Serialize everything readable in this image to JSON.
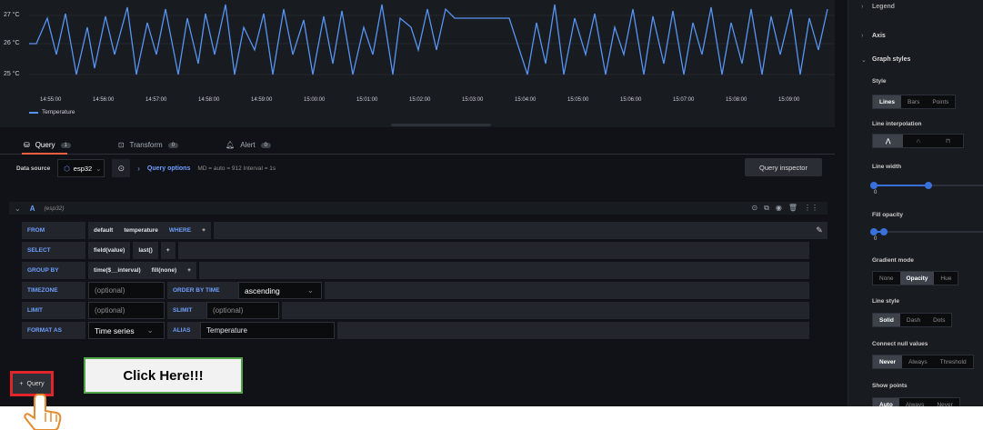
{
  "graph": {
    "y_ticks": [
      "27 °C",
      "26 °C",
      "25 °C"
    ],
    "x_ticks": [
      "14:55:00",
      "14:56:00",
      "14:57:00",
      "14:58:00",
      "14:59:00",
      "15:00:00",
      "15:01:00",
      "15:02:00",
      "15:03:00",
      "15:04:00",
      "15:05:00",
      "15:06:00",
      "15:07:00",
      "15:08:00",
      "15:09:00"
    ],
    "legend": "Temperature",
    "series_color": "#5794f2"
  },
  "tabs": [
    {
      "label": "Query",
      "count": "1"
    },
    {
      "label": "Transform",
      "count": "0"
    },
    {
      "label": "Alert",
      "count": "0"
    }
  ],
  "datasource": {
    "label": "Data source",
    "value": "esp32",
    "query_options": "Query options",
    "meta": "MD = auto = 912   Interval = 1s",
    "inspector": "Query inspector"
  },
  "query": {
    "letter": "A",
    "ds_name": "(esp32)",
    "from": {
      "kw": "FROM",
      "policy": "default",
      "measurement": "temperature",
      "where": "WHERE",
      "plus": "+"
    },
    "select": {
      "kw": "SELECT",
      "field": "field(value)",
      "fn": "last()",
      "plus": "+"
    },
    "group_by": {
      "kw": "GROUP BY",
      "time": "time($__interval)",
      "fill": "fill(none)",
      "plus": "+"
    },
    "timezone": {
      "kw": "TIMEZONE",
      "placeholder": "(optional)",
      "order_kw": "ORDER BY TIME",
      "order_val": "ascending"
    },
    "limit": {
      "kw": "LIMIT",
      "placeholder": "(optional)",
      "slimit_kw": "SLIMIT",
      "slimit_placeholder": "(optional)"
    },
    "format": {
      "kw": "FORMAT AS",
      "value": "Time series",
      "alias_kw": "ALIAS",
      "alias_val": "Temperature"
    }
  },
  "add_query": "Query",
  "add_query_plus": "+",
  "callout": "Click Here!!!",
  "right_panel": {
    "legend": "Legend",
    "axis": "Axis",
    "graph_styles": "Graph styles",
    "style_label": "Style",
    "style_opts": [
      "Lines",
      "Bars",
      "Points"
    ],
    "line_interp": "Line interpolation",
    "line_width": "Line width",
    "line_width_value": "0",
    "fill_opacity": "Fill opacity",
    "fill_opacity_value": "0",
    "gradient_mode": "Gradient mode",
    "gradient_opts": [
      "None",
      "Opacity",
      "Hue"
    ],
    "line_style": "Line style",
    "line_style_opts": [
      "Solid",
      "Dash",
      "Dots"
    ],
    "connect_null": "Connect null values",
    "connect_opts": [
      "Never",
      "Always",
      "Threshold"
    ],
    "show_points": "Show points",
    "show_points_opts": [
      "Auto",
      "Always",
      "Never"
    ]
  },
  "accent": "#f55f3e",
  "highlight": "#e0252b"
}
